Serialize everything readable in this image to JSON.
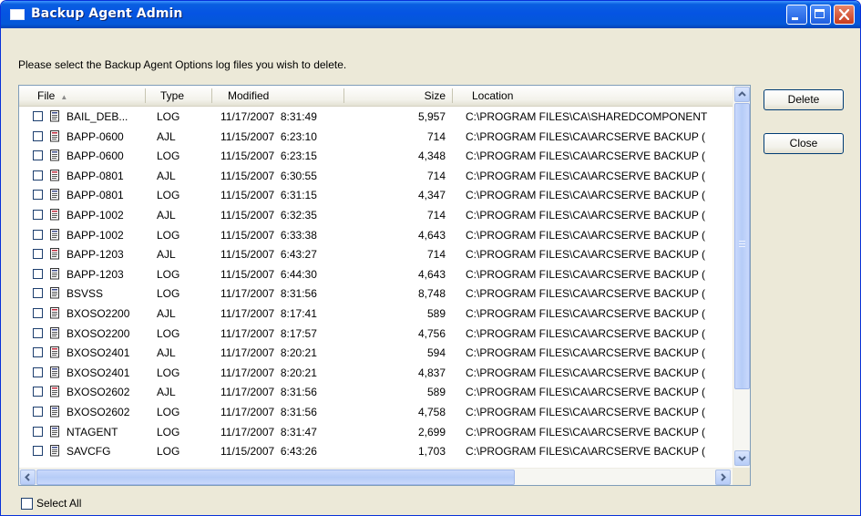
{
  "window": {
    "title": "Backup Agent Admin",
    "accent": "#0554e3",
    "controls": [
      "minimize-icon",
      "maximize-icon",
      "close-icon"
    ]
  },
  "instructions": "Please select the Backup Agent Options log files you wish to delete.",
  "columns": {
    "file": "File",
    "type": "Type",
    "modified": "Modified",
    "size": "Size",
    "location": "Location",
    "sort_indicator": "▲"
  },
  "rows": [
    {
      "file": "BAIL_DEB...",
      "type": "LOG",
      "modified": "11/17/2007  8:31:49",
      "size": "5,957",
      "location": "C:\\PROGRAM FILES\\CA\\SHAREDCOMPONENT",
      "checked": false,
      "icon": "log-file-icon"
    },
    {
      "file": "BAPP-0600",
      "type": "AJL",
      "modified": "11/15/2007  6:23:10",
      "size": "714",
      "location": "C:\\PROGRAM FILES\\CA\\ARCSERVE BACKUP (",
      "checked": false,
      "icon": "ajl-file-icon"
    },
    {
      "file": "BAPP-0600",
      "type": "LOG",
      "modified": "11/15/2007  6:23:15",
      "size": "4,348",
      "location": "C:\\PROGRAM FILES\\CA\\ARCSERVE BACKUP (",
      "checked": false,
      "icon": "log-file-icon"
    },
    {
      "file": "BAPP-0801",
      "type": "AJL",
      "modified": "11/15/2007  6:30:55",
      "size": "714",
      "location": "C:\\PROGRAM FILES\\CA\\ARCSERVE BACKUP (",
      "checked": false,
      "icon": "ajl-file-icon"
    },
    {
      "file": "BAPP-0801",
      "type": "LOG",
      "modified": "11/15/2007  6:31:15",
      "size": "4,347",
      "location": "C:\\PROGRAM FILES\\CA\\ARCSERVE BACKUP (",
      "checked": false,
      "icon": "log-file-icon"
    },
    {
      "file": "BAPP-1002",
      "type": "AJL",
      "modified": "11/15/2007  6:32:35",
      "size": "714",
      "location": "C:\\PROGRAM FILES\\CA\\ARCSERVE BACKUP (",
      "checked": false,
      "icon": "ajl-file-icon"
    },
    {
      "file": "BAPP-1002",
      "type": "LOG",
      "modified": "11/15/2007  6:33:38",
      "size": "4,643",
      "location": "C:\\PROGRAM FILES\\CA\\ARCSERVE BACKUP (",
      "checked": false,
      "icon": "log-file-icon"
    },
    {
      "file": "BAPP-1203",
      "type": "AJL",
      "modified": "11/15/2007  6:43:27",
      "size": "714",
      "location": "C:\\PROGRAM FILES\\CA\\ARCSERVE BACKUP (",
      "checked": false,
      "icon": "ajl-file-icon"
    },
    {
      "file": "BAPP-1203",
      "type": "LOG",
      "modified": "11/15/2007  6:44:30",
      "size": "4,643",
      "location": "C:\\PROGRAM FILES\\CA\\ARCSERVE BACKUP (",
      "checked": false,
      "icon": "log-file-icon"
    },
    {
      "file": "BSVSS",
      "type": "LOG",
      "modified": "11/17/2007  8:31:56",
      "size": "8,748",
      "location": "C:\\PROGRAM FILES\\CA\\ARCSERVE BACKUP (",
      "checked": false,
      "icon": "log-file-icon"
    },
    {
      "file": "BXOSO2200",
      "type": "AJL",
      "modified": "11/17/2007  8:17:41",
      "size": "589",
      "location": "C:\\PROGRAM FILES\\CA\\ARCSERVE BACKUP (",
      "checked": false,
      "icon": "ajl-file-icon"
    },
    {
      "file": "BXOSO2200",
      "type": "LOG",
      "modified": "11/17/2007  8:17:57",
      "size": "4,756",
      "location": "C:\\PROGRAM FILES\\CA\\ARCSERVE BACKUP (",
      "checked": false,
      "icon": "log-file-icon"
    },
    {
      "file": "BXOSO2401",
      "type": "AJL",
      "modified": "11/17/2007  8:20:21",
      "size": "594",
      "location": "C:\\PROGRAM FILES\\CA\\ARCSERVE BACKUP (",
      "checked": false,
      "icon": "ajl-file-icon"
    },
    {
      "file": "BXOSO2401",
      "type": "LOG",
      "modified": "11/17/2007  8:20:21",
      "size": "4,837",
      "location": "C:\\PROGRAM FILES\\CA\\ARCSERVE BACKUP (",
      "checked": false,
      "icon": "log-file-icon"
    },
    {
      "file": "BXOSO2602",
      "type": "AJL",
      "modified": "11/17/2007  8:31:56",
      "size": "589",
      "location": "C:\\PROGRAM FILES\\CA\\ARCSERVE BACKUP (",
      "checked": false,
      "icon": "ajl-file-icon"
    },
    {
      "file": "BXOSO2602",
      "type": "LOG",
      "modified": "11/17/2007  8:31:56",
      "size": "4,758",
      "location": "C:\\PROGRAM FILES\\CA\\ARCSERVE BACKUP (",
      "checked": false,
      "icon": "log-file-icon"
    },
    {
      "file": "NTAGENT",
      "type": "LOG",
      "modified": "11/17/2007  8:31:47",
      "size": "2,699",
      "location": "C:\\PROGRAM FILES\\CA\\ARCSERVE BACKUP (",
      "checked": false,
      "icon": "log-file-icon"
    },
    {
      "file": "SAVCFG",
      "type": "LOG",
      "modified": "11/15/2007  6:43:26",
      "size": "1,703",
      "location": "C:\\PROGRAM FILES\\CA\\ARCSERVE BACKUP (",
      "checked": false,
      "icon": "log-file-icon"
    }
  ],
  "buttons": {
    "delete": "Delete",
    "close": "Close"
  },
  "select_all": {
    "label": "Select All",
    "checked": false
  }
}
